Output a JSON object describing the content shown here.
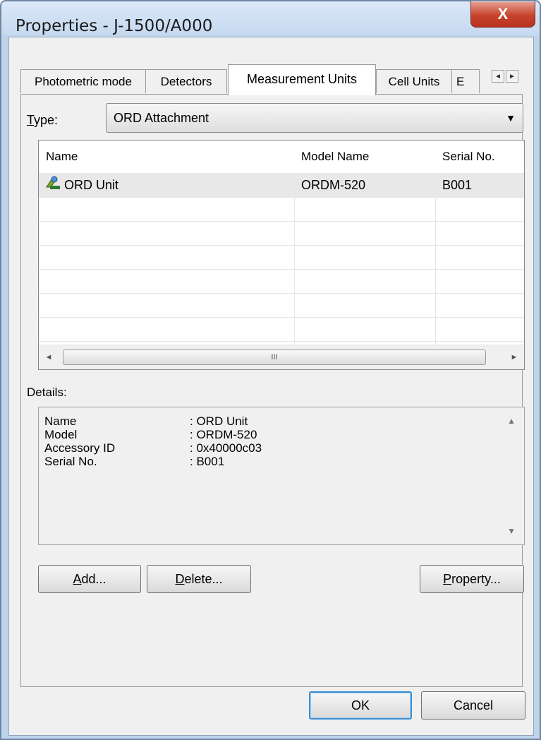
{
  "window": {
    "title": "Properties - J-1500/A000",
    "close_glyph": "X"
  },
  "tabs": [
    {
      "label": "Photometric mode"
    },
    {
      "label": "Detectors"
    },
    {
      "label": "Measurement Units",
      "active": true
    },
    {
      "label": "Cell Units"
    },
    {
      "label": "E"
    }
  ],
  "tab_scroll": {
    "left": "◄",
    "right": "►"
  },
  "type_field": {
    "label_first": "T",
    "label_rest": "ype:",
    "value": "ORD Attachment",
    "arrow": "▼"
  },
  "list": {
    "columns": [
      "Name",
      "Model Name",
      "Serial No."
    ],
    "rows": [
      {
        "icon": "ord-unit-icon",
        "name": "ORD Unit",
        "model": "ORDM-520",
        "serial": "B001",
        "selected": true
      }
    ],
    "hscroll": {
      "left": "◄",
      "right": "►",
      "grip": "III"
    }
  },
  "details": {
    "label": "Details:",
    "lines": [
      {
        "key": "Name",
        "value": ": ORD Unit"
      },
      {
        "key": "Model",
        "value": ": ORDM-520"
      },
      {
        "key": "Accessory ID",
        "value": ": 0x40000c03"
      },
      {
        "key": "Serial No.",
        "value": ": B001"
      }
    ],
    "scroll_up": "▲",
    "scroll_down": "▼"
  },
  "buttons": {
    "add": {
      "mn": "A",
      "rest": "dd..."
    },
    "delete": {
      "mn": "D",
      "rest": "elete..."
    },
    "property": {
      "mn": "P",
      "rest": "roperty..."
    },
    "ok": "OK",
    "cancel": "Cancel"
  }
}
